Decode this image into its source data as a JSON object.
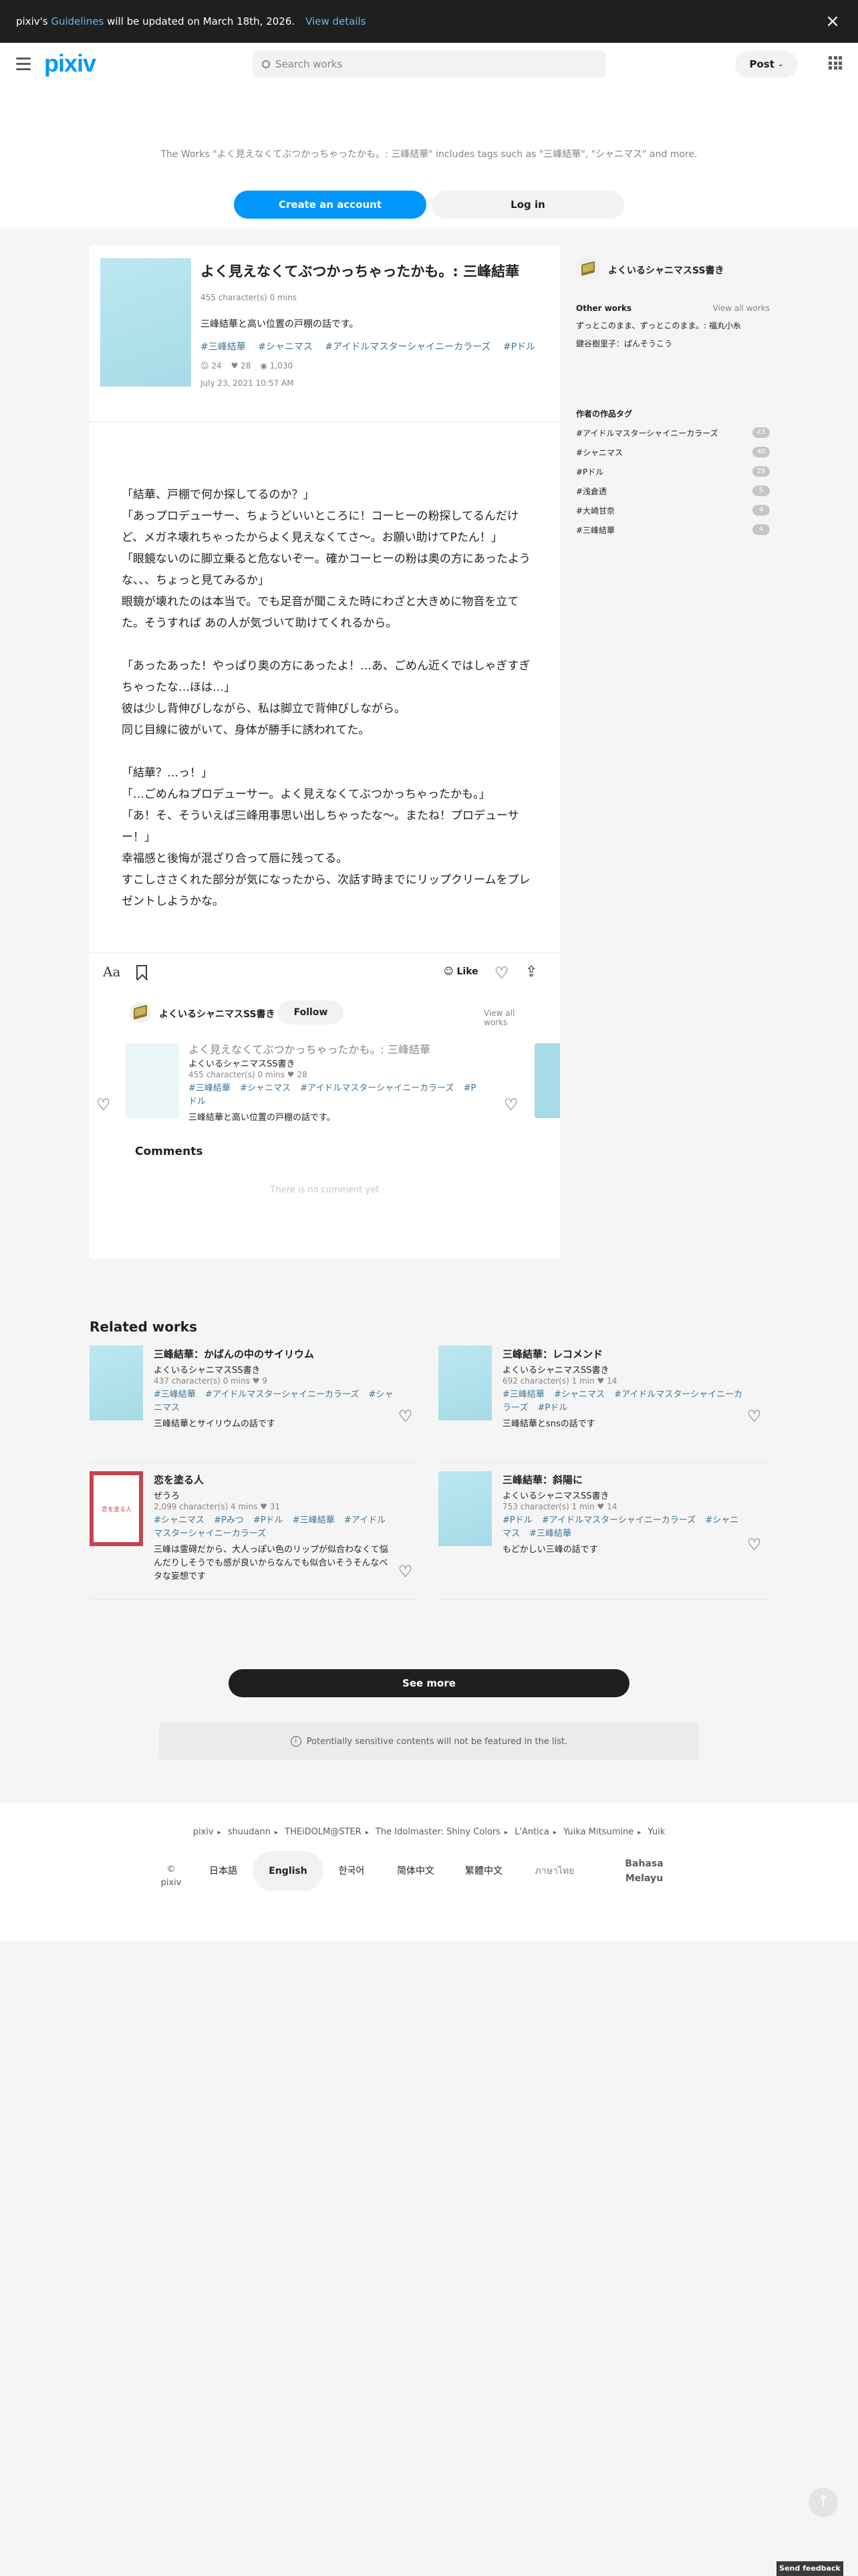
{
  "announcement": {
    "prefix": "pixiv's",
    "link": "Guidelines",
    "suffix": "will be updated on March 18th, 2026.",
    "details": "View details",
    "close": "×"
  },
  "header": {
    "logo": "pixiv",
    "search_placeholder": "Search works",
    "post": "Post"
  },
  "intro": {
    "message": "The Works \"よく見えなくてぶつかっちゃったかも。: 三峰結華\" includes tags such as \"三峰結華\", \"シャニマス\" and more.",
    "create": "Create an account",
    "login": "Log in"
  },
  "novel": {
    "title": "よく見えなくてぶつかっちゃったかも。: 三峰結華",
    "meta": "455 character(s)  0 mins",
    "caption": "三峰結華と高い位置の戸棚の話です。",
    "tags": [
      "#三峰結華",
      "#シャニマス",
      "#アイドルマスターシャイニーカラーズ",
      "#Pドル"
    ],
    "stats": {
      "likes": "24",
      "bookmarks": "28",
      "views": "1,030"
    },
    "date": "July 23, 2021 10:57 AM",
    "body": [
      "「結華、戸棚で何か探してるのか？」",
      "「あっプロデューサー、ちょうどいいところに！コーヒーの粉探してるんだけど、メガネ壊れちゃったからよく見えなくてさ〜。お願い助けてPたん！」",
      "「眼鏡ないのに脚立乗ると危ないぞー。確かコーヒーの粉は奥の方にあったような、、、ちょっと見てみるか」",
      "眼鏡が壊れたのは本当で。でも足音が聞こえた時にわざと大きめに物音を立てた。そうすれば あの人が気づいて助けてくれるから。",
      "",
      "「あったあった！やっぱり奥の方にあったよ！…あ、ごめん近くではしゃぎすぎちゃったな…ほは…」",
      "彼は少し背伸びしながら、私は脚立で背伸びしながら。",
      "同じ目線に彼がいて、身体が勝手に誘われてた。",
      "",
      "「結華？…っ！」",
      "「…ごめんねプロデューサー。よく見えなくてぶつかっちゃったかも。」",
      "「あ！そ、そういえば三峰用事思い出しちゃったな〜。またね！プロデューサー！」",
      "幸福感と後悔が混ざり合って唇に残ってる。",
      "すこしささくれた部分が気になったから、次話す時までにリップクリームをプレゼントしようかな。"
    ]
  },
  "toolbar": {
    "font": "Aa",
    "like": "Like"
  },
  "author": {
    "name": "よくいるシャニマスSS書き",
    "follow": "Follow",
    "view_all": "View all works"
  },
  "series_card": {
    "title": "よく見えなくてぶつかっちゃったかも。: 三峰結華",
    "author": "よくいるシャニマスSS書き",
    "meta": "455 character(s)  0 mins  ♥ 28",
    "tags": [
      "#三峰結華",
      "#シャニマス",
      "#アイドルマスターシャイニーカラーズ",
      "#Pドル"
    ],
    "desc": "三峰結華と高い位置の戸棚の話です。"
  },
  "comments": {
    "title": "Comments",
    "empty": "There is no comment yet"
  },
  "sidebar": {
    "author": "よくいるシャニマスSS書き",
    "other_works_label": "Other works",
    "view_all": "View all works",
    "other_works": [
      "ずっとこのまま、ずっとこのまま。: 福丸小糸",
      "鍵谷樹里子：ぱんそうこう"
    ],
    "tags_label": "作者の作品タグ",
    "tags": [
      {
        "name": "#アイドルマスターシャイニーカラーズ",
        "count": "43"
      },
      {
        "name": "#シャニマス",
        "count": "40"
      },
      {
        "name": "#Pドル",
        "count": "29"
      },
      {
        "name": "#浅倉透",
        "count": "5"
      },
      {
        "name": "#大崎甘奈",
        "count": "4"
      },
      {
        "name": "#三峰結華",
        "count": "4"
      }
    ]
  },
  "related": {
    "title": "Related works",
    "items": [
      {
        "title": "三峰結華：かばんの中のサイリウム",
        "author": "よくいるシャニマスSS書き",
        "meta": "437 character(s)  0 mins  ♥ 9",
        "tags": [
          "#三峰結華",
          "#アイドルマスターシャイニーカラーズ",
          "#シャニマス"
        ],
        "desc": "三峰結華とサイリウムの話です"
      },
      {
        "title": "三峰結華：レコメンド",
        "author": "よくいるシャニマスSS書き",
        "meta": "692 character(s)  1 min  ♥ 14",
        "tags": [
          "#三峰結華",
          "#シャニマス",
          "#アイドルマスターシャイニーカラーズ",
          "#Pドル"
        ],
        "desc": "三峰結華とsnsの話です"
      },
      {
        "title": "恋を塗る人",
        "author": "ぜうろ",
        "meta": "2,099 character(s)  4 mins  ♥ 31",
        "tags": [
          "#シャニマス",
          "#Pみつ",
          "#Pドル",
          "#三峰結華",
          "#アイドルマスターシャイニーカラーズ"
        ],
        "desc": "三峰は霊碍だから、大人っぽい色のリップが似合わなくて悩んだりしそうでも感が良いからなんでも似合いそうそんなベタな妄想です",
        "cover_text": "恋を塗る人"
      },
      {
        "title": "三峰結華：斜陽に",
        "author": "よくいるシャニマスSS書き",
        "meta": "753 character(s)  1 min  ♥ 14",
        "tags": [
          "#Pドル",
          "#アイドルマスターシャイニーカラーズ",
          "#シャニマス",
          "#三峰結華"
        ],
        "desc": "もどかしい三峰の話です"
      }
    ],
    "see_more": "See more",
    "sensitive": "Potentially sensitive contents will not be featured in the list."
  },
  "footer": {
    "crumbs": [
      "pixiv",
      "shuudann",
      "THEiDOLM@STER",
      "The Idolmaster: Shiny Colors",
      "L'Antica",
      "Yuika Mitsumine",
      "Yuik"
    ],
    "copyright": "© pixiv",
    "languages": [
      "日本語",
      "English",
      "한국어",
      "简体中文",
      "繁體中文",
      "ภาษาไทย",
      "Bahasa Melayu"
    ]
  },
  "feedback": "Send feedback"
}
